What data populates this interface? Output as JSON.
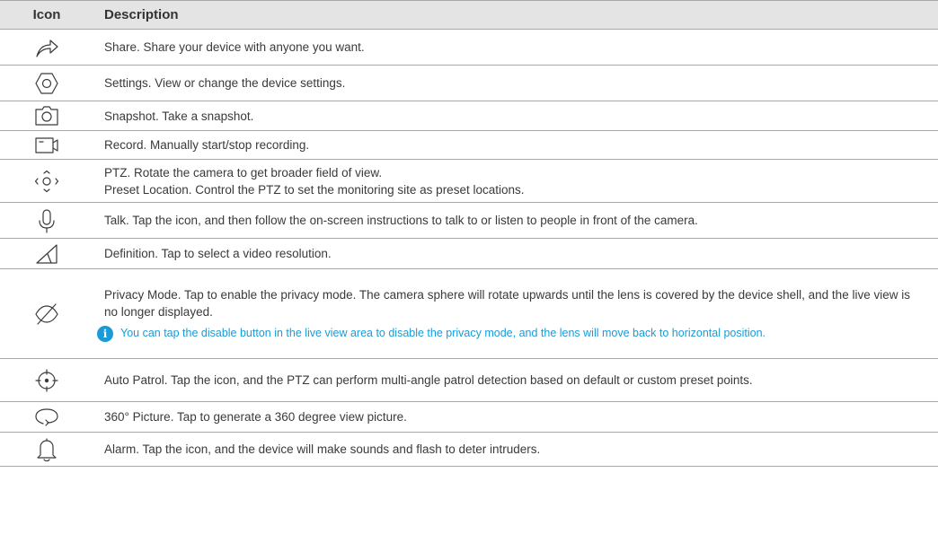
{
  "header": {
    "icon_label": "Icon",
    "description_label": "Description"
  },
  "rows": [
    {
      "icon": "share-icon",
      "text": "Share. Share your device with anyone you want."
    },
    {
      "icon": "settings-icon",
      "text": "Settings. View or change the device settings."
    },
    {
      "icon": "snapshot-icon",
      "text": "Snapshot. Take a snapshot."
    },
    {
      "icon": "record-icon",
      "text": "Record. Manually start/stop recording."
    },
    {
      "icon": "ptz-icon",
      "text": "PTZ. Rotate the camera to get broader field of view.",
      "text2": "Preset Location. Control the PTZ to set the monitoring site as preset locations."
    },
    {
      "icon": "microphone-icon",
      "text": "Talk. Tap the icon, and then follow the on-screen instructions to talk to or listen to people in front of the camera."
    },
    {
      "icon": "definition-icon",
      "text": "Definition. Tap to select a video resolution."
    },
    {
      "icon": "privacy-icon",
      "text": "Privacy Mode. Tap to enable the privacy mode. The camera sphere will rotate upwards until the lens is covered by the device shell, and the live view is no longer displayed.",
      "note": "You can tap the disable button in the live view area to disable the privacy mode, and the lens will move back to horizontal position."
    },
    {
      "icon": "auto-patrol-icon",
      "text": "Auto Patrol. Tap the icon, and the PTZ can perform multi-angle patrol detection based on default or custom preset points."
    },
    {
      "icon": "panorama-icon",
      "text": "360° Picture. Tap to generate a 360 degree view picture."
    },
    {
      "icon": "alarm-bell-icon",
      "text": "Alarm. Tap the icon, and the device will make sounds and flash to deter intruders."
    }
  ],
  "colors": {
    "header_bg": "#e4e4e4",
    "border": "#a8a8a8",
    "note_blue": "#1a9bd8",
    "text": "#3a3a3a"
  }
}
